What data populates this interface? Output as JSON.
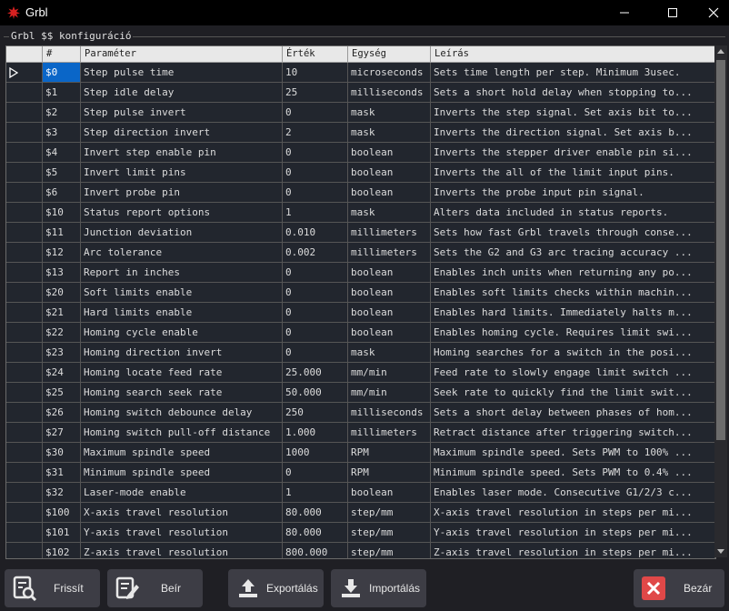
{
  "window": {
    "title": "Grbl"
  },
  "group_title": "Grbl $$ konfiguráció",
  "columns": {
    "hash": "#",
    "param": "Paraméter",
    "value": "Érték",
    "unit": "Egység",
    "desc": "Leírás"
  },
  "rows": [
    {
      "id": "$0",
      "param": "Step pulse time",
      "value": "10",
      "unit": "microseconds",
      "desc": "Sets time length per step. Minimum 3usec."
    },
    {
      "id": "$1",
      "param": "Step idle delay",
      "value": "25",
      "unit": "milliseconds",
      "desc": "Sets a short hold delay when stopping to..."
    },
    {
      "id": "$2",
      "param": "Step pulse invert",
      "value": "0",
      "unit": "mask",
      "desc": "Inverts the step signal. Set axis bit to..."
    },
    {
      "id": "$3",
      "param": "Step direction invert",
      "value": "2",
      "unit": "mask",
      "desc": "Inverts the direction signal. Set axis b..."
    },
    {
      "id": "$4",
      "param": "Invert step enable pin",
      "value": "0",
      "unit": "boolean",
      "desc": "Inverts the stepper driver enable pin si..."
    },
    {
      "id": "$5",
      "param": "Invert limit pins",
      "value": "0",
      "unit": "boolean",
      "desc": "Inverts the all of the limit input pins."
    },
    {
      "id": "$6",
      "param": "Invert probe pin",
      "value": "0",
      "unit": "boolean",
      "desc": "Inverts the probe input pin signal."
    },
    {
      "id": "$10",
      "param": "Status report options",
      "value": "1",
      "unit": "mask",
      "desc": "Alters data included in status reports."
    },
    {
      "id": "$11",
      "param": "Junction deviation",
      "value": "0.010",
      "unit": "millimeters",
      "desc": "Sets how fast Grbl travels through conse..."
    },
    {
      "id": "$12",
      "param": "Arc tolerance",
      "value": "0.002",
      "unit": "millimeters",
      "desc": "Sets the G2 and G3 arc tracing accuracy ..."
    },
    {
      "id": "$13",
      "param": "Report in inches",
      "value": "0",
      "unit": "boolean",
      "desc": "Enables inch units when returning any po..."
    },
    {
      "id": "$20",
      "param": "Soft limits enable",
      "value": "0",
      "unit": "boolean",
      "desc": "Enables soft limits checks within machin..."
    },
    {
      "id": "$21",
      "param": "Hard limits enable",
      "value": "0",
      "unit": "boolean",
      "desc": "Enables hard limits. Immediately halts m..."
    },
    {
      "id": "$22",
      "param": "Homing cycle enable",
      "value": "0",
      "unit": "boolean",
      "desc": "Enables homing cycle. Requires limit swi..."
    },
    {
      "id": "$23",
      "param": "Homing direction invert",
      "value": "0",
      "unit": "mask",
      "desc": "Homing searches for a switch in the posi..."
    },
    {
      "id": "$24",
      "param": "Homing locate feed rate",
      "value": "25.000",
      "unit": "mm/min",
      "desc": "Feed rate to slowly engage limit switch ..."
    },
    {
      "id": "$25",
      "param": "Homing search seek rate",
      "value": "50.000",
      "unit": "mm/min",
      "desc": "Seek rate to quickly find the limit swit..."
    },
    {
      "id": "$26",
      "param": "Homing switch debounce delay",
      "value": "250",
      "unit": "milliseconds",
      "desc": "Sets a short delay between phases of hom..."
    },
    {
      "id": "$27",
      "param": "Homing switch pull-off distance",
      "value": "1.000",
      "unit": "millimeters",
      "desc": "Retract distance after triggering switch..."
    },
    {
      "id": "$30",
      "param": "Maximum spindle speed",
      "value": "1000",
      "unit": "RPM",
      "desc": "Maximum spindle speed. Sets PWM to 100% ..."
    },
    {
      "id": "$31",
      "param": "Minimum spindle speed",
      "value": "0",
      "unit": "RPM",
      "desc": "Minimum spindle speed. Sets PWM to 0.4% ..."
    },
    {
      "id": "$32",
      "param": "Laser-mode enable",
      "value": "1",
      "unit": "boolean",
      "desc": "Enables laser mode. Consecutive G1/2/3 c..."
    },
    {
      "id": "$100",
      "param": "X-axis travel resolution",
      "value": "80.000",
      "unit": "step/mm",
      "desc": "X-axis travel resolution in steps per mi..."
    },
    {
      "id": "$101",
      "param": "Y-axis travel resolution",
      "value": "80.000",
      "unit": "step/mm",
      "desc": "Y-axis travel resolution in steps per mi..."
    },
    {
      "id": "$102",
      "param": "Z-axis travel resolution",
      "value": "800.000",
      "unit": "step/mm",
      "desc": "Z-axis travel resolution in steps per mi..."
    }
  ],
  "buttons": {
    "refresh": "Frissít",
    "write": "Beír",
    "export": "Exportálás",
    "import": "Importálás",
    "close": "Bezár"
  },
  "colors": {
    "selection": "#0a66c8",
    "close_icon": "#e04848",
    "app_icon": "#d62020"
  }
}
